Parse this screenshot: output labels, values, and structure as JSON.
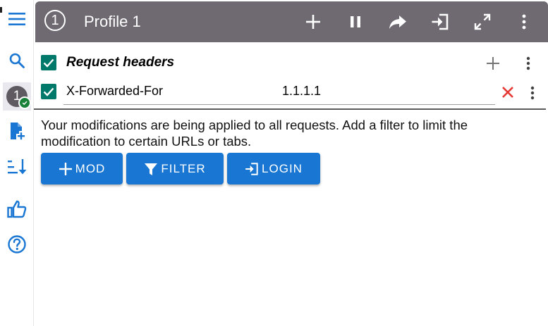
{
  "header": {
    "profile_number": "1",
    "title": "Profile 1"
  },
  "sidebar": {
    "active_profile_number": "1"
  },
  "section": {
    "title": "Request headers"
  },
  "header_row": {
    "name": "X-Forwarded-For",
    "value": "1.1.1.1"
  },
  "message": "Your modifications are being applied to all requests. Add a filter to limit the modification to certain URLs or tabs.",
  "buttons": {
    "mod": "MOD",
    "filter": "FILTER",
    "login": "LOGIN"
  },
  "colors": {
    "header_bg": "#6f6a72",
    "accent": "#1976d2",
    "checkbox": "#00796b",
    "delete": "#e53935"
  }
}
